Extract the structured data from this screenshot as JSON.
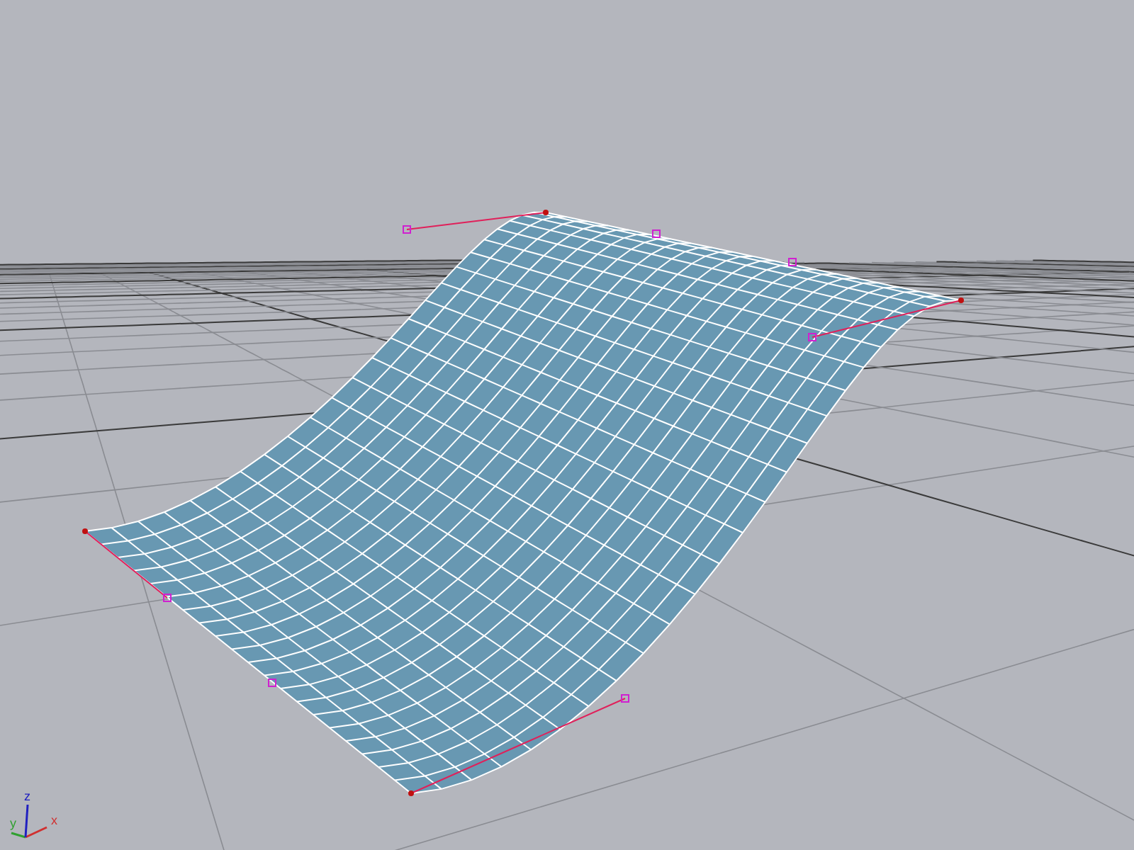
{
  "viewport": {
    "axis_gizmo": {
      "axes": [
        {
          "label": "x",
          "color": "#d03030"
        },
        {
          "label": "y",
          "color": "#30a030"
        },
        {
          "label": "z",
          "color": "#2020c0"
        }
      ]
    }
  }
}
